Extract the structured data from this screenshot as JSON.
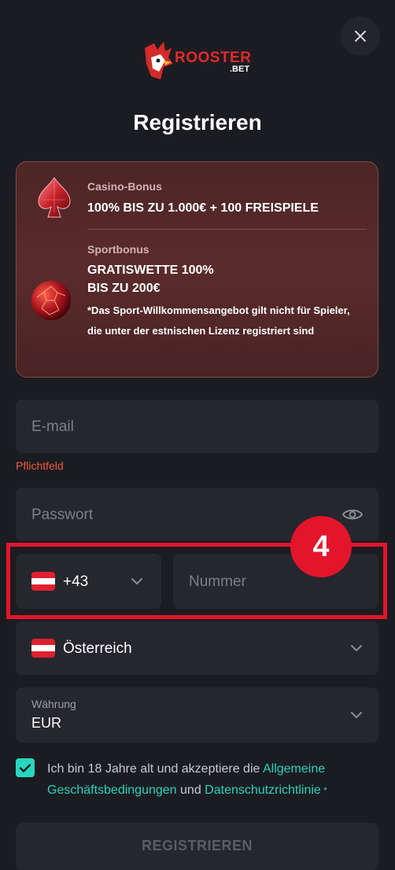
{
  "logo": {
    "line1": "ROOSTER",
    "line2": ".BET"
  },
  "title": "Registrieren",
  "bonus": {
    "casino_label": "Casino-Bonus",
    "casino_value": "100% BIS ZU 1.000€ + 100 FREISPIELE",
    "sport_label": "Sportbonus",
    "sport_value_line1": "GRATISWETTE 100%",
    "sport_value_line2": "BIS ZU 200€",
    "sport_note": "*Das Sport-Willkommensangebot gilt nicht für Spieler, die unter der estnischen Lizenz registriert sind"
  },
  "form": {
    "email_placeholder": "E-mail",
    "email_error": "Pflichtfeld",
    "password_placeholder": "Passwort",
    "phone_code": "+43",
    "phone_placeholder": "Nummer",
    "country": "Österreich",
    "currency_label": "Währung",
    "currency_value": "EUR"
  },
  "terms": {
    "text_before": "Ich bin 18 Jahre alt und akzeptiere die ",
    "link1": "Allgemeine Geschäftsbedingungen",
    "text_mid": " und ",
    "link2": "Datenschutzrichtlinie",
    "required_mark": " *",
    "checked": true
  },
  "submit_label": "REGISTRIEREN",
  "step_badge": "4",
  "colors": {
    "accent": "#2ad3bd",
    "error": "#ee5a3c",
    "highlight": "#e3152b",
    "field_bg": "#25262e",
    "page_bg": "#1b1c21"
  }
}
